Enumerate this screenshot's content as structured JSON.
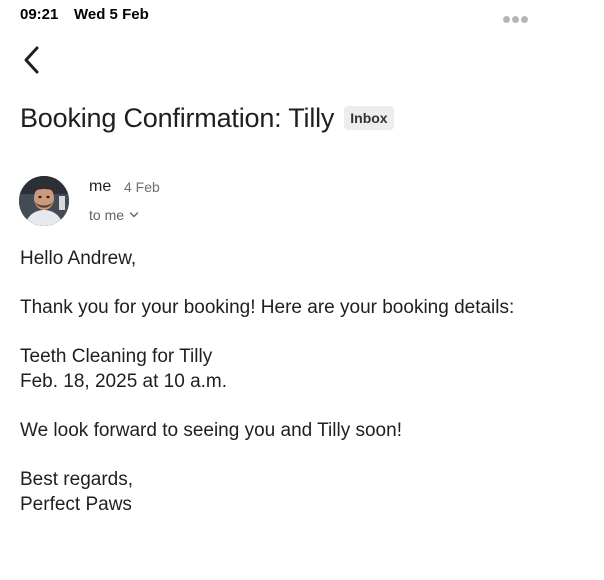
{
  "status_bar": {
    "time": "09:21",
    "date": "Wed 5 Feb"
  },
  "email": {
    "subject": "Booking Confirmation: Tilly",
    "label": "Inbox",
    "sender": "me",
    "sent_date": "4 Feb",
    "recipient_line": "to me",
    "body": {
      "greeting": "Hello Andrew,",
      "thanks": "Thank you for your booking! Here are your booking details:",
      "service": "Teeth Cleaning for Tilly",
      "appointment": "Feb. 18, 2025 at 10 a.m.",
      "closing_line": "We look forward to seeing you and Tilly soon!",
      "signoff": "Best regards,",
      "signature": "Perfect Paws"
    }
  },
  "icons": {
    "back": "chevron-left-icon",
    "more": "more-horizontal-icon",
    "expand": "chevron-down-icon"
  }
}
